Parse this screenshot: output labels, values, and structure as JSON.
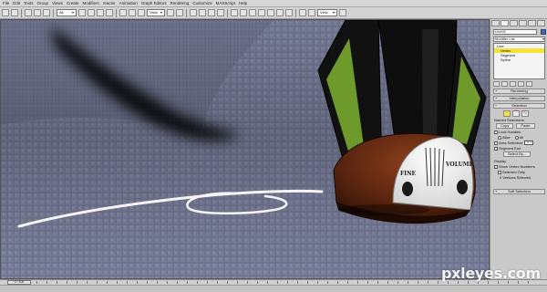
{
  "menu": {
    "items": [
      "File",
      "Edit",
      "Tools",
      "Group",
      "Views",
      "Create",
      "Modifiers",
      "reactor",
      "Animation",
      "Graph Editors",
      "Rendering",
      "Customize",
      "MAXScript",
      "Help"
    ]
  },
  "toolbar": {
    "selection_filter": "All",
    "reference_coord": "View",
    "named_selection": "View"
  },
  "viewport": {
    "text_fine": "FINE",
    "text_volume": "VOLUME"
  },
  "command_panel": {
    "object_name": "Line01",
    "modifier_list": "Modifier List",
    "stack": {
      "items": [
        "Line",
        "Vertex",
        "Segment",
        "Spline"
      ],
      "selected_index": 1
    },
    "rollouts": {
      "rendering": "Rendering",
      "interpolation": "Interpolation",
      "selection": "Selection",
      "soft_selection": "Soft Selection"
    },
    "named_selections": {
      "label": "Named Selections:",
      "copy": "Copy",
      "paste": "Paste"
    },
    "lock_handles": {
      "label": "Lock Handles",
      "alike": "Alike",
      "all": "All"
    },
    "area_selection": {
      "label": "Area Selection:",
      "value": "0.1"
    },
    "segment_end": "Segment End",
    "select_by": "Select By...",
    "display": {
      "label": "Display",
      "show_vertex_numbers": "Show Vertex Numbers",
      "selected_only": "Selected Only",
      "status": "0 Vertices Selected"
    }
  },
  "timeline": {
    "slider": "0 / 100"
  },
  "watermark": "pxleyes.com",
  "colors": {
    "object_color": "#2f6bd0",
    "selection_yellow": "#f6e23a"
  }
}
